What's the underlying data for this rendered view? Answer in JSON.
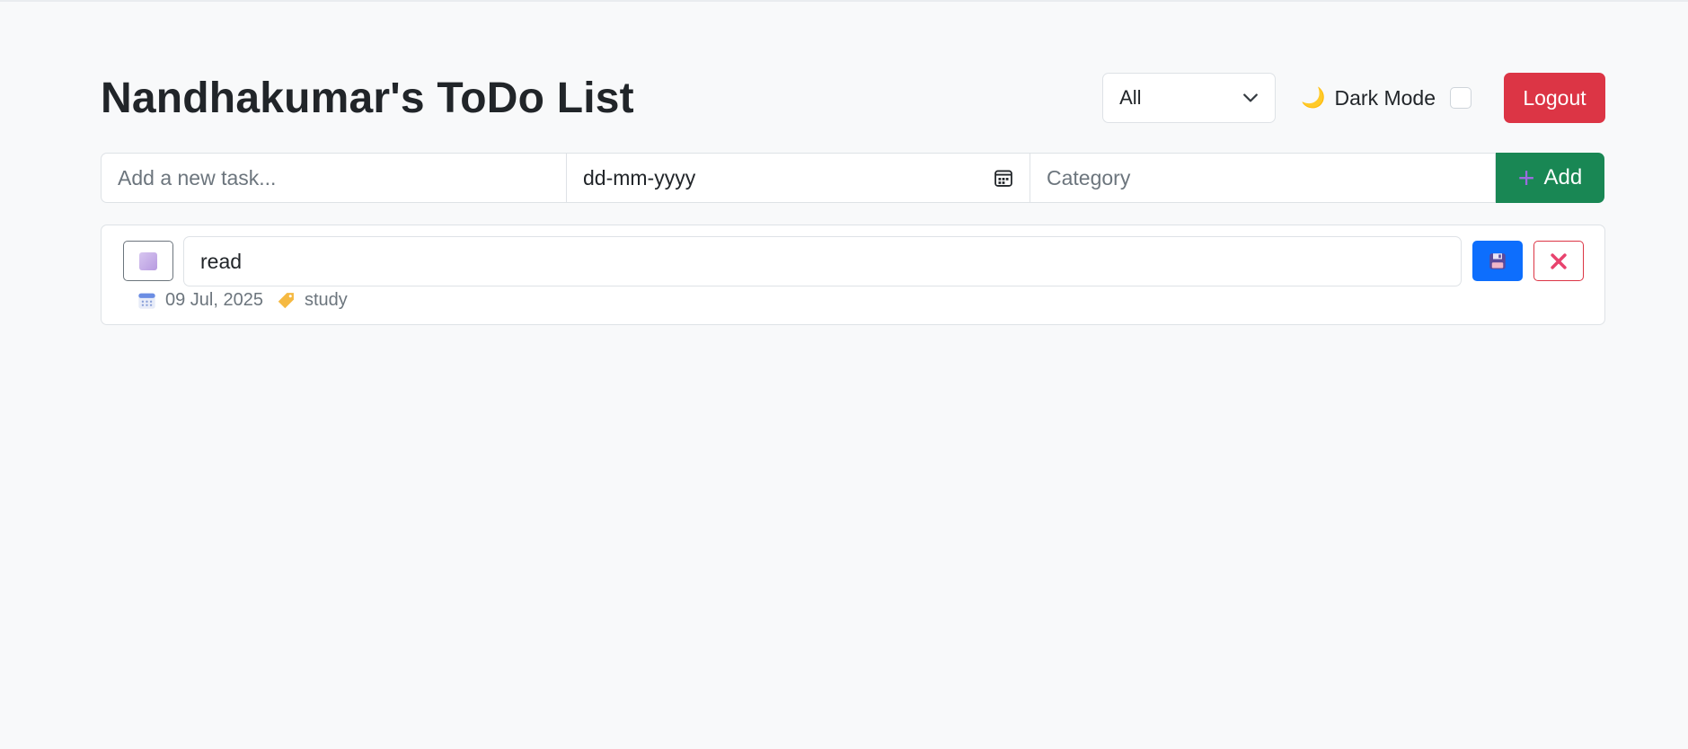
{
  "header": {
    "title": "Nandhakumar's ToDo List",
    "filter_value": "All",
    "dark_mode_label": "Dark Mode",
    "logout_label": "Logout"
  },
  "add_form": {
    "task_placeholder": "Add a new task...",
    "date_placeholder": "dd-mm-yyyy",
    "category_placeholder": "Category",
    "add_label": "Add"
  },
  "tasks": [
    {
      "text": "read",
      "date": "09 Jul, 2025",
      "category": "study",
      "completed": false
    }
  ],
  "colors": {
    "background": "#f8f9fa",
    "logout": "#dc3545",
    "add": "#198754",
    "save": "#0d6efd",
    "delete": "#dc3545"
  },
  "icons": {
    "filter": "chevron-down-icon",
    "dark_mode": "moon-icon",
    "date": "calendar-icon",
    "add": "plus-icon",
    "save": "floppy-disk-icon",
    "delete": "close-icon",
    "meta_date": "calendar-icon",
    "meta_category": "tag-icon"
  }
}
